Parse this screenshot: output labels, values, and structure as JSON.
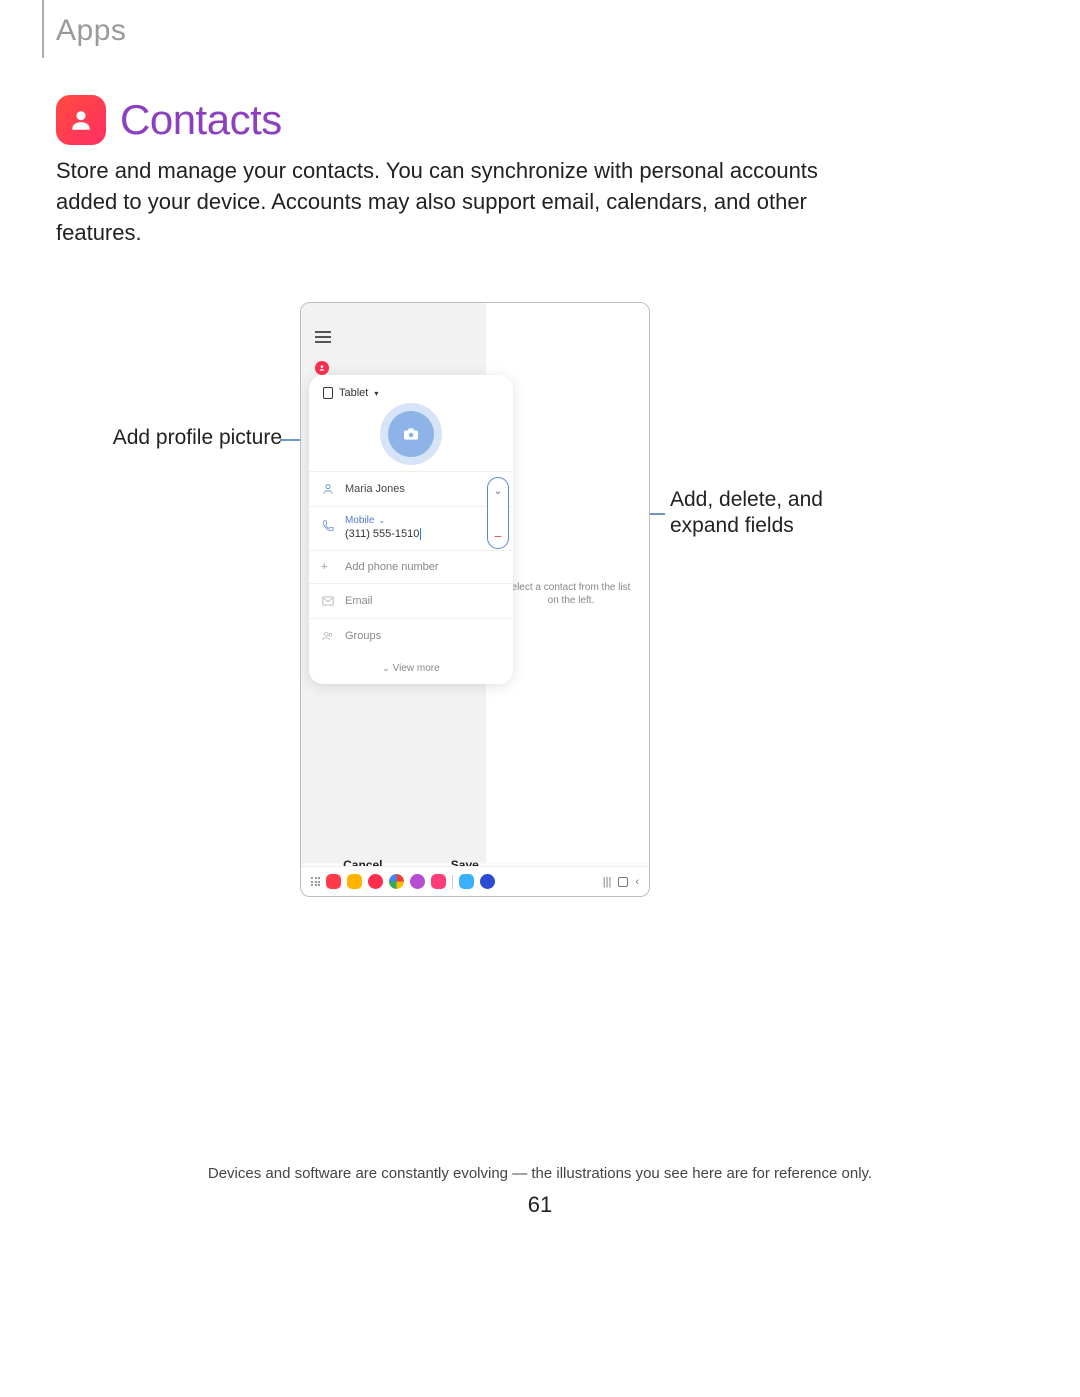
{
  "section_label": "Apps",
  "heading": "Contacts",
  "intro": "Store and manage your contacts. You can synchronize with personal accounts added to your device. Accounts may also support email, calendars, and other features.",
  "callouts": {
    "profile": "Add profile picture",
    "fields": "Add, delete, and expand fields"
  },
  "device": {
    "storage_selector": "Tablet",
    "right_hint": "elect a contact from the list on the left.",
    "fields": {
      "name_value": "Maria Jones",
      "phone_type": "Mobile",
      "phone_value": "(311) 555-1510",
      "add_phone": "Add phone number",
      "email": "Email",
      "groups": "Groups",
      "view_more": "View more"
    },
    "actions": {
      "cancel": "Cancel",
      "save": "Save"
    }
  },
  "disclaimer": "Devices and software are constantly evolving — the illustrations you see here are for reference only.",
  "page_number": "61",
  "colors": {
    "accent": "#8c3fbf",
    "icon_red": "#ff2e4d",
    "field_blue": "#4e7dd0"
  }
}
